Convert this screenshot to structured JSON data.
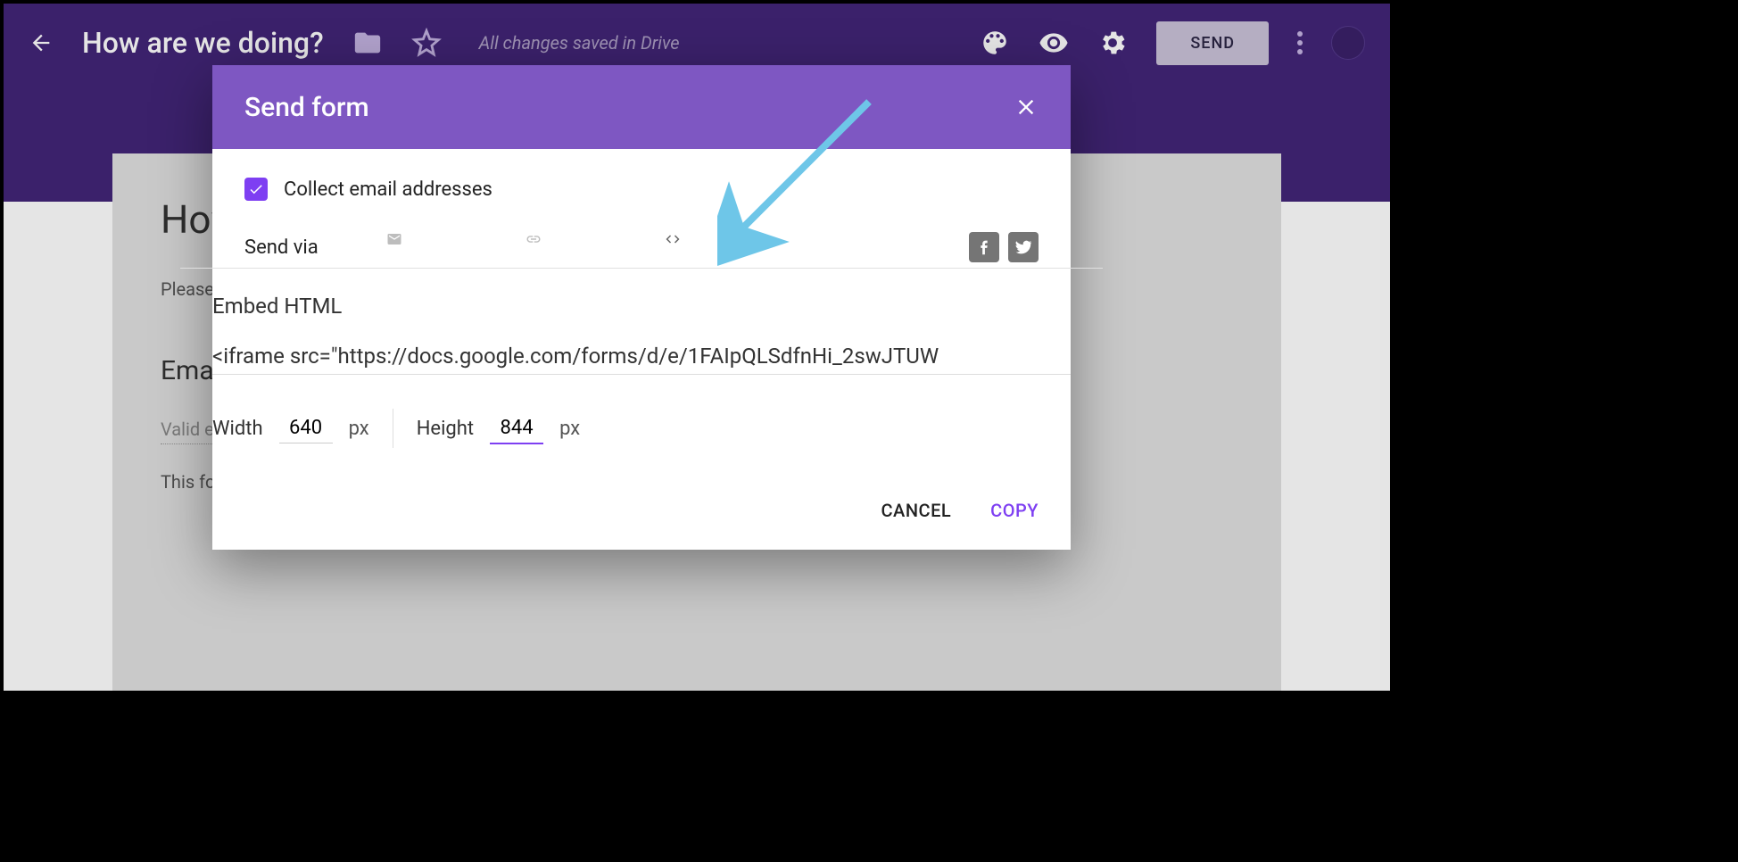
{
  "topbar": {
    "title": "How are we doing?",
    "save_status": "All changes saved in Drive",
    "send_button": "SEND"
  },
  "page": {
    "heading_visible": "How",
    "subtitle_visible": "Please t",
    "email_label": "Email",
    "email_hint": "Valid em",
    "note_visible": "This forn"
  },
  "dialog": {
    "title": "Send form",
    "collect_label": "Collect email addresses",
    "collect_checked": true,
    "send_via_label": "Send via",
    "tabs": {
      "email": "email-icon",
      "link": "link-icon",
      "embed": "embed-icon",
      "active": "embed"
    },
    "embed": {
      "heading": "Embed HTML",
      "code": "<iframe src=\"https://docs.google.com/forms/d/e/1FAIpQLSdfnHi_2swJTUW",
      "width_label": "Width",
      "width_value": "640",
      "height_label": "Height",
      "height_value": "844",
      "unit": "px"
    },
    "actions": {
      "cancel": "CANCEL",
      "copy": "COPY"
    }
  }
}
